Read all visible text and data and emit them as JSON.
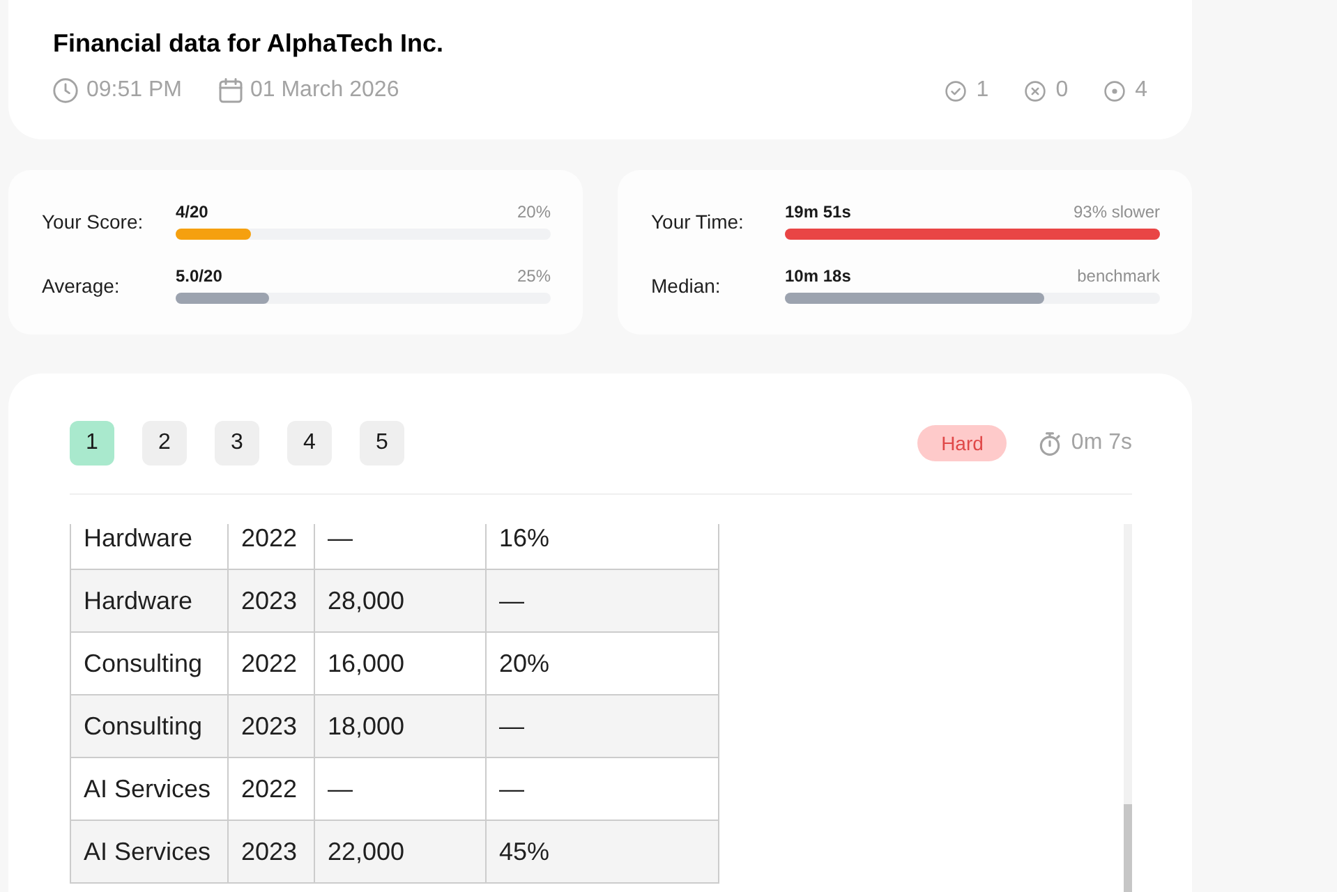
{
  "header": {
    "title": "Financial data for AlphaTech Inc.",
    "time": "09:51 PM",
    "date": "01 March 2026",
    "counts": [
      {
        "kind": "correct",
        "value": "1"
      },
      {
        "kind": "wrong",
        "value": "0"
      },
      {
        "kind": "pending",
        "value": "4"
      }
    ]
  },
  "stats": [
    {
      "metrics": [
        {
          "label": "Your Score:",
          "value": "4/20",
          "note": "20%",
          "level": 0.2,
          "color": "#f5a00f"
        },
        {
          "label": "Average:",
          "value": "5.0/20",
          "note": "25%",
          "level": 0.25,
          "color": "#9ca3af"
        }
      ]
    },
    {
      "metrics": [
        {
          "label": "Your Time:",
          "value": "19m 51s",
          "note": "93% slower",
          "level": 1,
          "color": "#e94545"
        },
        {
          "label": "Median:",
          "value": "10m 18s",
          "note": "benchmark",
          "level": 0.69,
          "color": "#9ca3af"
        }
      ]
    }
  ],
  "question_nav": {
    "pages": [
      {
        "label": "1",
        "selected": true
      },
      {
        "label": "2",
        "selected": false
      },
      {
        "label": "3",
        "selected": false
      },
      {
        "label": "4",
        "selected": false
      },
      {
        "label": "5",
        "selected": false
      }
    ],
    "difficulty": {
      "kind": "hard",
      "label": "Hard"
    },
    "timer": "0m 7s"
  },
  "table": {
    "rows": [
      [
        "Hardware",
        "2022",
        "—",
        "16%"
      ],
      [
        "Hardware",
        "2023",
        "28,000",
        "—"
      ],
      [
        "Consulting",
        "2022",
        "16,000",
        "20%"
      ],
      [
        "Consulting",
        "2023",
        "18,000",
        "—"
      ],
      [
        "AI Services",
        "2022",
        "—",
        "—"
      ],
      [
        "AI Services",
        "2023",
        "22,000",
        "45%"
      ]
    ]
  }
}
